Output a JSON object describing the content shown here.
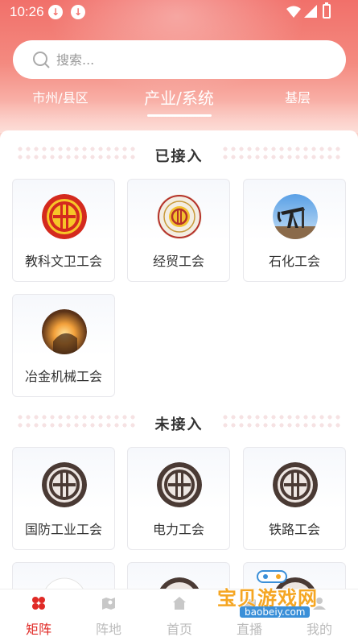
{
  "status": {
    "time": "10:26"
  },
  "search": {
    "placeholder": "搜索..."
  },
  "tabs": [
    {
      "label": "市州/县区"
    },
    {
      "label": "产业/系统"
    },
    {
      "label": "基层"
    }
  ],
  "connected": {
    "title": "已接入",
    "items": [
      {
        "label": "教科文卫工会",
        "icon": "union-emblem-red-icon"
      },
      {
        "label": "经贸工会",
        "icon": "trade-union-seal-icon"
      },
      {
        "label": "石化工会",
        "icon": "oil-pump-icon"
      },
      {
        "label": "冶金机械工会",
        "icon": "metallurgy-furnace-icon"
      }
    ]
  },
  "not_connected": {
    "title": "未接入",
    "items": [
      {
        "label": "国防工业工会",
        "icon": "union-emblem-gray-icon"
      },
      {
        "label": "电力工会",
        "icon": "union-emblem-gray-icon"
      },
      {
        "label": "铁路工会",
        "icon": "union-emblem-gray-icon"
      }
    ]
  },
  "bottom_nav": [
    {
      "label": "矩阵",
      "icon": "grid-icon",
      "active": true
    },
    {
      "label": "阵地",
      "icon": "map-pin-icon",
      "active": false
    },
    {
      "label": "首页",
      "icon": "home-icon",
      "active": false
    },
    {
      "label": "直播",
      "icon": "live-icon",
      "active": false
    },
    {
      "label": "我的",
      "icon": "user-icon",
      "active": false
    }
  ],
  "watermark": {
    "text": "宝贝游戏网",
    "url": "baobeiy.com"
  },
  "colors": {
    "accent": "#e02a26",
    "header": "#f1706a"
  }
}
